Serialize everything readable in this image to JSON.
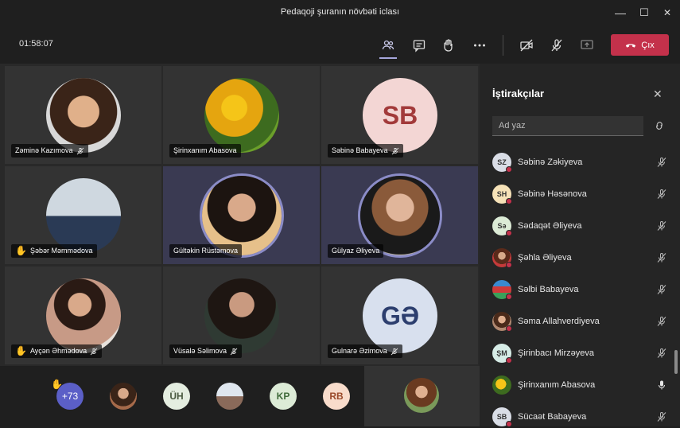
{
  "window": {
    "title": "Pedaqoji şuranın növbəti iclası",
    "minimize": "—",
    "maximize": "☐",
    "close": "✕"
  },
  "toolbar": {
    "timer": "01:58:07",
    "leave_label": "Çıx"
  },
  "tiles": [
    {
      "name": "Zəminə Kazımova",
      "muted": true,
      "hand": false
    },
    {
      "name": "Şirinxanım Abasova",
      "muted": false,
      "hand": false
    },
    {
      "name": "Səbinə Babayeva",
      "muted": true,
      "hand": false,
      "initials": "SB"
    },
    {
      "name": "Şəbər Məmmədova",
      "muted": false,
      "hand": true
    },
    {
      "name": "Gültəkin Rüstəmova",
      "muted": false,
      "hand": false
    },
    {
      "name": "Gülyaz Əliyeva",
      "muted": false,
      "hand": false
    },
    {
      "name": "Ayçən Əhmədova",
      "muted": true,
      "hand": true
    },
    {
      "name": "Vüsalə Səlimova",
      "muted": true,
      "hand": false
    },
    {
      "name": "Gulnarə Əzimova",
      "muted": true,
      "hand": false,
      "initials": "GƏ"
    }
  ],
  "roster": [
    {
      "label": "+73"
    },
    {
      "label": ""
    },
    {
      "label": "ÜH"
    },
    {
      "label": ""
    },
    {
      "label": "KP"
    },
    {
      "label": "RB"
    }
  ],
  "panel": {
    "title": "İştirakçılar",
    "search_placeholder": "Ad yaz",
    "participants": [
      {
        "initials": "SZ",
        "name": "Səbinə Zəkiyeva",
        "muted": true
      },
      {
        "initials": "SH",
        "name": "Səbinə Həsənova",
        "muted": true
      },
      {
        "initials": "Sə",
        "name": "Sədaqət Əliyeva",
        "muted": true
      },
      {
        "initials": "",
        "name": "Şəhla Əliyeva",
        "muted": true
      },
      {
        "initials": "",
        "name": "Səlbi Babayeva",
        "muted": true
      },
      {
        "initials": "",
        "name": "Səma Allahverdiyeva",
        "muted": true
      },
      {
        "initials": "ŞM",
        "name": "Şirinbacı Mirzəyeva",
        "muted": true
      },
      {
        "initials": "",
        "name": "Şirinxanım Abasova",
        "muted": false
      },
      {
        "initials": "SB",
        "name": "Sücaət Babayeva",
        "muted": true
      }
    ]
  },
  "colors": {
    "accent": "#8b8cc7",
    "leave": "#c4314b",
    "presence_busy": "#c4314b"
  }
}
